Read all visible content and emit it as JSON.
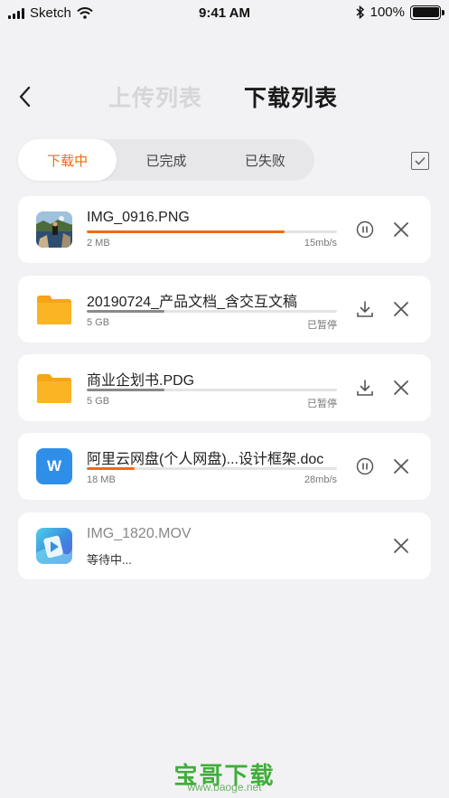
{
  "status_bar": {
    "carrier": "Sketch",
    "time": "9:41 AM",
    "battery": "100%"
  },
  "header": {
    "back_icon": "chevron-left-icon",
    "tab_upload": "上传列表",
    "tab_download": "下载列表"
  },
  "filters": {
    "items": [
      "下载中",
      "已完成",
      "已失败"
    ],
    "active": "下载中",
    "select_all_icon": "checkbox-icon"
  },
  "colors": {
    "accent": "#f06a10",
    "paused_bar": "#8a8a8a",
    "track": "#e4e4e6",
    "background": "#f2f2f4",
    "folder": "#fbb424",
    "word": "#2f8fe8"
  },
  "downloads": [
    {
      "name": "IMG_0916.PNG",
      "size": "2 MB",
      "status": "15mb/s",
      "progress": 0.79,
      "icon": "photo-thumbnail",
      "action": "pause-icon"
    },
    {
      "name": "20190724_产品文档_含交互文稿",
      "size": "5 GB",
      "status": "已暂停",
      "progress": 0.31,
      "icon": "folder-icon",
      "action": "download-icon"
    },
    {
      "name": "商业企划书.PDG",
      "size": "5 GB",
      "status": "已暂停",
      "progress": 0.31,
      "icon": "folder-icon",
      "action": "download-icon"
    },
    {
      "name": "阿里云网盘(个人网盘)...设计框架.doc",
      "size": "18 MB",
      "status": "28mb/s",
      "progress": 0.19,
      "icon": "word-doc-icon",
      "icon_letter": "W",
      "action": "pause-icon"
    },
    {
      "name": "IMG_1820.MOV",
      "status": "等待中...",
      "icon": "video-thumbnail"
    }
  ],
  "watermark": {
    "brand": "宝哥下载",
    "url": "www.baoge.net"
  }
}
